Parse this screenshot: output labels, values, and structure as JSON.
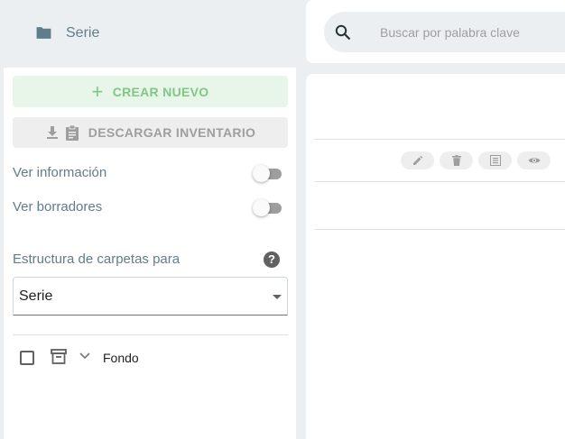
{
  "header": {
    "title": "Serie",
    "folder_icon": "folder-icon"
  },
  "sidebar": {
    "new_button": {
      "icon": "plus-icon",
      "label": "CREAR NUEVO"
    },
    "download_button": {
      "icon": "download-clipboard-icon",
      "label": "DESCARGAR INVENTARIO"
    },
    "toggles": [
      {
        "label": "Ver información",
        "on": false
      },
      {
        "label": "Ver borradores",
        "on": false
      }
    ],
    "structure_label": "Estructura de carpetas para",
    "help_icon": "help-icon",
    "select_value": "Serie",
    "tree": [
      {
        "label": "Fondo",
        "checked": false,
        "icon": "archive-icon",
        "expand_icon": "chevron-down-icon"
      }
    ]
  },
  "search": {
    "placeholder": "Buscar por palabra clave",
    "value": ""
  },
  "row_actions": [
    "edit-icon",
    "delete-icon",
    "list-icon",
    "view-icon"
  ],
  "colors": {
    "accent_green": "#81c784",
    "muted": "#607d8b"
  }
}
